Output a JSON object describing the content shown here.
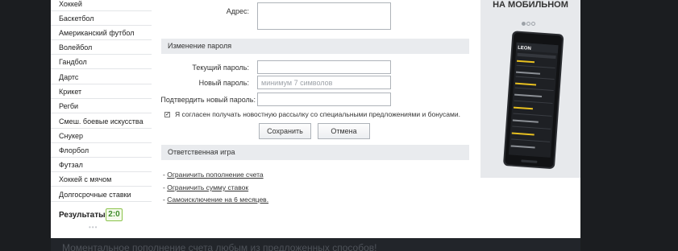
{
  "sidebar": {
    "items": [
      "Хоккей",
      "Баскетбол",
      "Американский футбол",
      "Волейбол",
      "Гандбол",
      "Дартс",
      "Крикет",
      "Регби",
      "Смеш. боевые искусства",
      "Снукер",
      "Флорбол",
      "Футзал",
      "Хоккей с мячом",
      "Долгосрочные ставки"
    ],
    "results_label": "Результаты",
    "results_count": "2:0"
  },
  "form": {
    "address_label": "Адрес:",
    "address_value": "",
    "password_section": "Изменение пароля",
    "current_password_label": "Текущий пароль:",
    "new_password_label": "Новый пароль:",
    "new_password_placeholder": "минимум 7 символов",
    "confirm_password_label": "Подтвердить новый пароль:",
    "newsletter_checked": true,
    "newsletter_label": "Я согласен получать новостную рассылку со специальными предложениями и бонусами.",
    "save_label": "Сохранить",
    "cancel_label": "Отмена"
  },
  "responsible": {
    "section": "Ответственная игра",
    "links": [
      "Ограничить пополнение счета",
      "Ограничить сумму ставок",
      "Самоисключение на 6 месяцев."
    ]
  },
  "banner": {
    "title": "НА МОБИЛЬНОМ",
    "phone_logo": "LEON"
  },
  "footer": {
    "text": "Моментальное пополнение счета любым из предложенных способов!"
  },
  "colors": {
    "accent_green": "#3d8b2a",
    "phone_accent": "#e8c020"
  }
}
